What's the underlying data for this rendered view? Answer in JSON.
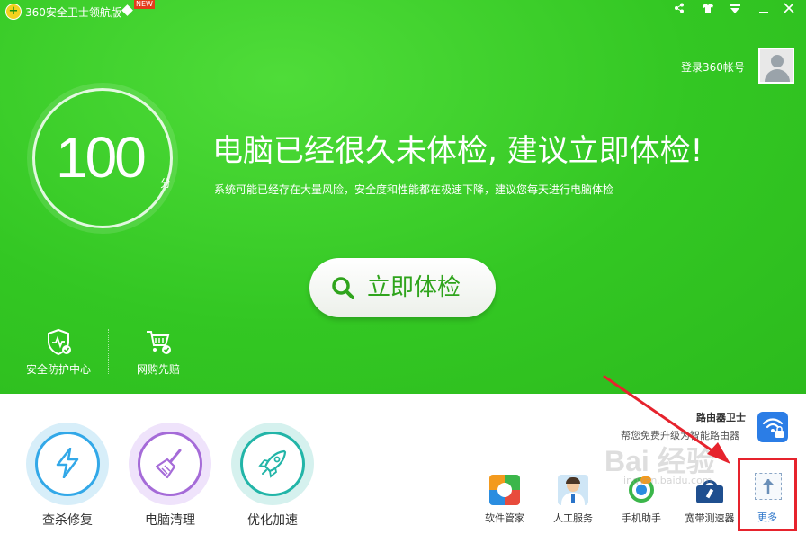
{
  "window": {
    "title": "360安全卫士领航版",
    "new_badge": "NEW",
    "controls": [
      "share-icon",
      "skin-icon",
      "menu-icon",
      "minimize-icon",
      "close-icon"
    ]
  },
  "account": {
    "login_label": "登录360帐号"
  },
  "score": {
    "value": "100",
    "unit": "分"
  },
  "headline": "电脑已经很久未体检, 建议立即体检!",
  "subline": "系统可能已经存在大量风险，安全度和性能都在极速下降，建议您每天进行电脑体检",
  "scan_button": {
    "label": "立即体检"
  },
  "left_tools": [
    {
      "label": "安全防护中心",
      "icon": "shield-icon"
    },
    {
      "label": "网购先赔",
      "icon": "cart-icon"
    }
  ],
  "big_tools": [
    {
      "label": "查杀修复",
      "icon": "lightning-icon",
      "color": "#32a8e8"
    },
    {
      "label": "电脑清理",
      "icon": "broom-icon",
      "color": "#a56bd8"
    },
    {
      "label": "优化加速",
      "icon": "rocket-icon",
      "color": "#22b5a8"
    }
  ],
  "router": {
    "title": "路由器卫士",
    "subtitle": "帮您免费升级为智能路由器"
  },
  "apps": [
    {
      "label": "软件管家",
      "icon": "software-manager-icon"
    },
    {
      "label": "人工服务",
      "icon": "human-service-icon"
    },
    {
      "label": "手机助手",
      "icon": "phone-assistant-icon"
    },
    {
      "label": "宽带测速器",
      "icon": "broadband-speed-icon"
    }
  ],
  "more": {
    "label": "更多"
  },
  "watermark": {
    "text": "Bai 经验",
    "sub": "jingyan.baidu.com"
  },
  "colors": {
    "accent_green": "#33c723",
    "highlight_red": "#e6232d",
    "link_blue": "#2a74c9"
  }
}
